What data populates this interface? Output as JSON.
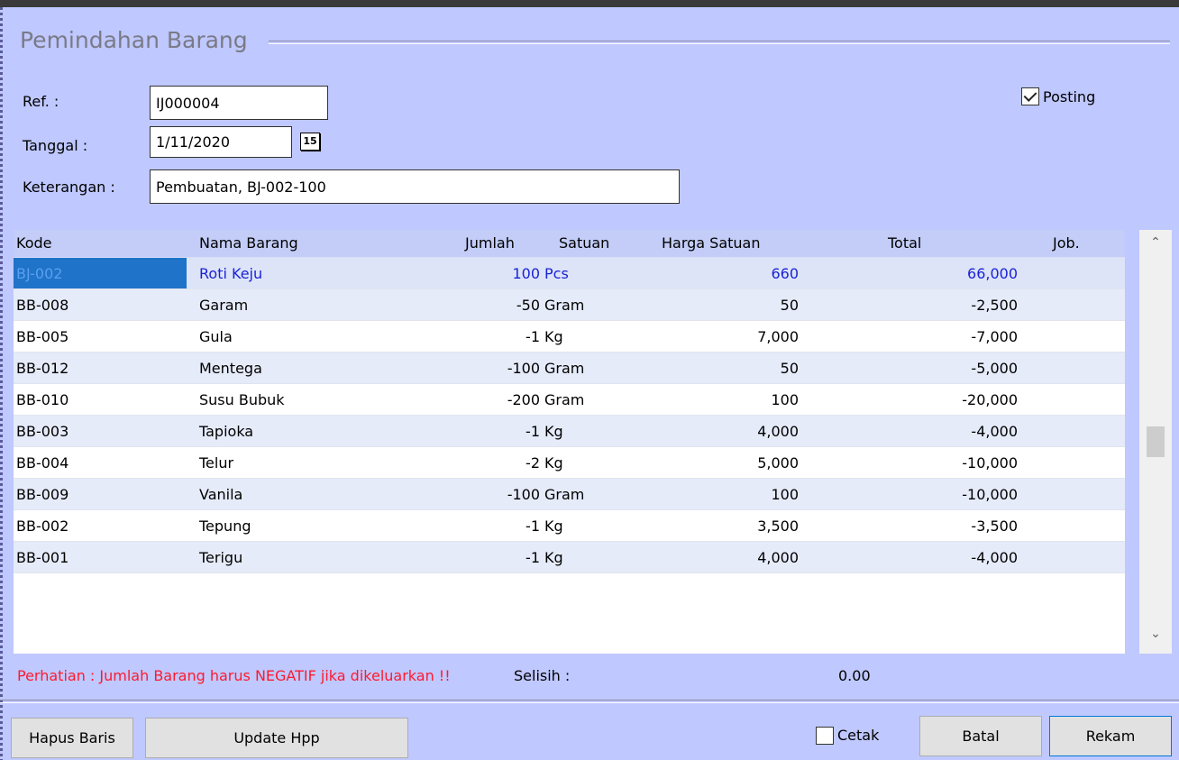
{
  "form": {
    "title": "Pemindahan Barang",
    "ref_label": "Ref. :",
    "ref_value": "IJ000004",
    "tanggal_label": "Tanggal :",
    "tanggal_value": "1/11/2020",
    "calendar_label": "15",
    "keterangan_label": "Keterangan :",
    "keterangan_value": "Pembuatan, BJ-002-100",
    "posting_label": "Posting",
    "posting_checked": true
  },
  "grid": {
    "columns": [
      "Kode",
      "Nama Barang",
      "Jumlah",
      "Satuan",
      "Harga Satuan",
      "Total",
      "Job."
    ],
    "rows": [
      {
        "kode": "BJ-002",
        "nama": "Roti Keju",
        "jumlah": "100",
        "satuan": "Pcs",
        "harga": "660",
        "total": "66,000",
        "job": ""
      },
      {
        "kode": "BB-008",
        "nama": "Garam",
        "jumlah": "-50",
        "satuan": "Gram",
        "harga": "50",
        "total": "-2,500",
        "job": ""
      },
      {
        "kode": "BB-005",
        "nama": "Gula",
        "jumlah": "-1",
        "satuan": "Kg",
        "harga": "7,000",
        "total": "-7,000",
        "job": ""
      },
      {
        "kode": "BB-012",
        "nama": "Mentega",
        "jumlah": "-100",
        "satuan": "Gram",
        "harga": "50",
        "total": "-5,000",
        "job": ""
      },
      {
        "kode": "BB-010",
        "nama": "Susu Bubuk",
        "jumlah": "-200",
        "satuan": "Gram",
        "harga": "100",
        "total": "-20,000",
        "job": ""
      },
      {
        "kode": "BB-003",
        "nama": "Tapioka",
        "jumlah": "-1",
        "satuan": "Kg",
        "harga": "4,000",
        "total": "-4,000",
        "job": ""
      },
      {
        "kode": "BB-004",
        "nama": "Telur",
        "jumlah": "-2",
        "satuan": "Kg",
        "harga": "5,000",
        "total": "-10,000",
        "job": ""
      },
      {
        "kode": "BB-009",
        "nama": "Vanila",
        "jumlah": "-100",
        "satuan": "Gram",
        "harga": "100",
        "total": "-10,000",
        "job": ""
      },
      {
        "kode": "BB-002",
        "nama": "Tepung",
        "jumlah": "-1",
        "satuan": "Kg",
        "harga": "3,500",
        "total": "-3,500",
        "job": ""
      },
      {
        "kode": "BB-001",
        "nama": "Terigu",
        "jumlah": "-1",
        "satuan": "Kg",
        "harga": "4,000",
        "total": "-4,000",
        "job": ""
      }
    ],
    "scroll_up_icon": "chevron-up-icon",
    "scroll_down_icon": "chevron-down-icon"
  },
  "footer": {
    "warning": "Perhatian : Jumlah Barang harus NEGATIF jika dikeluarkan !!",
    "selisih_label": "Selisih :",
    "selisih_value": "0.00",
    "hapus_baris": "Hapus Baris",
    "update_hpp": "Update Hpp",
    "cetak_label": "Cetak",
    "cetak_checked": false,
    "batal": "Batal",
    "rekam": "Rekam"
  },
  "colors": {
    "background": "#bfc8ff",
    "selected_text": "#1a22d6",
    "selected_cell": "#1f73c8",
    "warning": "#ff1a2e"
  }
}
